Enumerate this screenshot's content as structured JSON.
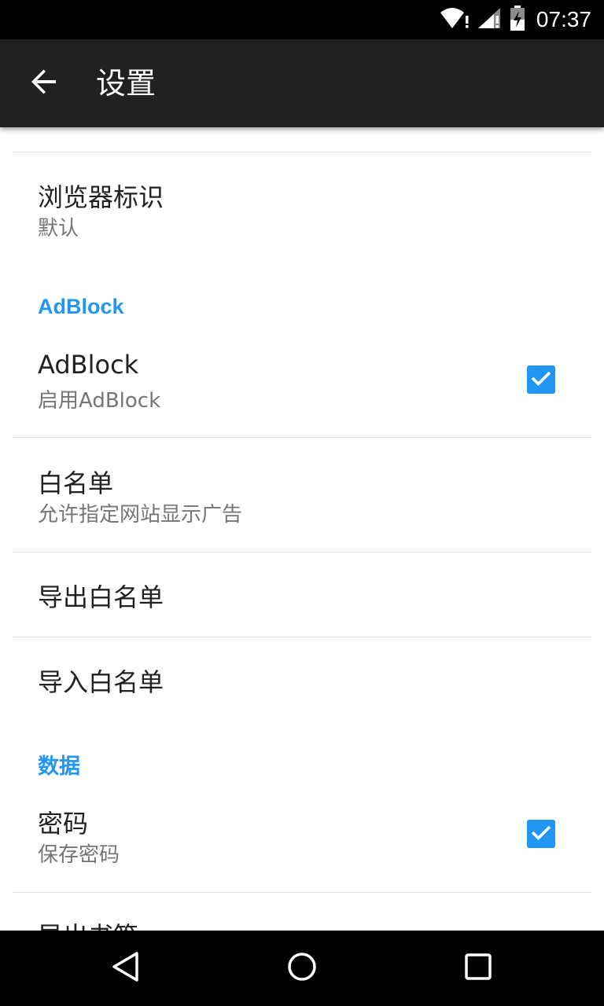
{
  "status_bar": {
    "time": "07:37",
    "icons": [
      "wifi-alert-icon",
      "signal-alert-icon",
      "battery-charging-icon"
    ]
  },
  "toolbar": {
    "title": "设置",
    "back_icon": "arrow-back-icon"
  },
  "settings": {
    "user_agent": {
      "title": "浏览器标识",
      "summary": "默认"
    },
    "adblock_category": "AdBlock",
    "adblock": {
      "title": "AdBlock",
      "summary": "启用AdBlock",
      "checked": true
    },
    "whitelist": {
      "title": "白名单",
      "summary": "允许指定网站显示广告"
    },
    "export_whitelist": {
      "title": "导出白名单"
    },
    "import_whitelist": {
      "title": "导入白名单"
    },
    "data_category": "数据",
    "password": {
      "title": "密码",
      "summary": "保存密码",
      "checked": true
    },
    "export_bookmarks": {
      "title": "导出书签"
    }
  },
  "colors": {
    "accent": "#2196f3",
    "toolbar": "#212121",
    "status_bar": "#000000",
    "nav_bar": "#000000"
  },
  "nav_bar": {
    "icons": [
      "back-triangle-icon",
      "home-circle-icon",
      "recents-square-icon"
    ]
  }
}
